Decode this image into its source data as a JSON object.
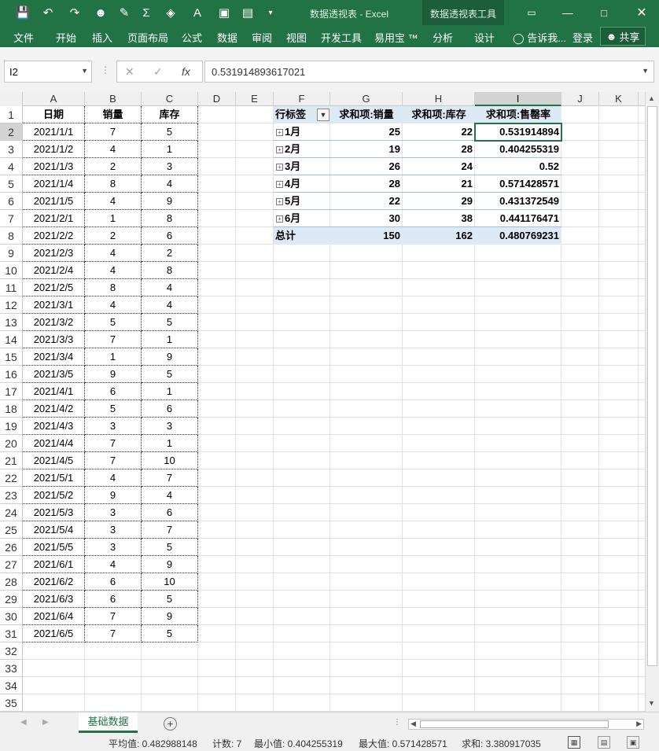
{
  "window": {
    "title": "数据透视表 - Excel",
    "context_tab_group": "数据透视表工具"
  },
  "ribbon": {
    "tabs": [
      "文件",
      "开始",
      "插入",
      "页面布局",
      "公式",
      "数据",
      "审阅",
      "视图",
      "开发工具",
      "易用宝 ™",
      "分析",
      "设计"
    ],
    "tell_me": "告诉我...",
    "login": "登录",
    "share": "共享"
  },
  "formula_bar": {
    "name_box": "I2",
    "fx": "fx",
    "value": "0.531914893617021"
  },
  "columns": [
    "A",
    "B",
    "C",
    "D",
    "E",
    "F",
    "G",
    "H",
    "I",
    "J",
    "K"
  ],
  "rows": [
    "1",
    "2",
    "3",
    "4",
    "5",
    "6",
    "7",
    "8",
    "9",
    "10",
    "11",
    "12",
    "13",
    "14",
    "15",
    "16",
    "17",
    "18",
    "19",
    "20",
    "21",
    "22",
    "23",
    "24",
    "25",
    "26",
    "27",
    "28",
    "29",
    "30",
    "31",
    "32",
    "33",
    "34",
    "35"
  ],
  "base_data": {
    "headers": [
      "日期",
      "销量",
      "库存"
    ],
    "records": [
      [
        "2021/1/1",
        "7",
        "5"
      ],
      [
        "2021/1/2",
        "4",
        "1"
      ],
      [
        "2021/1/3",
        "2",
        "3"
      ],
      [
        "2021/1/4",
        "8",
        "4"
      ],
      [
        "2021/1/5",
        "4",
        "9"
      ],
      [
        "2021/2/1",
        "1",
        "8"
      ],
      [
        "2021/2/2",
        "2",
        "6"
      ],
      [
        "2021/2/3",
        "4",
        "2"
      ],
      [
        "2021/2/4",
        "4",
        "8"
      ],
      [
        "2021/2/5",
        "8",
        "4"
      ],
      [
        "2021/3/1",
        "4",
        "4"
      ],
      [
        "2021/3/2",
        "5",
        "5"
      ],
      [
        "2021/3/3",
        "7",
        "1"
      ],
      [
        "2021/3/4",
        "1",
        "9"
      ],
      [
        "2021/3/5",
        "9",
        "5"
      ],
      [
        "2021/4/1",
        "6",
        "1"
      ],
      [
        "2021/4/2",
        "5",
        "6"
      ],
      [
        "2021/4/3",
        "3",
        "3"
      ],
      [
        "2021/4/4",
        "7",
        "1"
      ],
      [
        "2021/4/5",
        "7",
        "10"
      ],
      [
        "2021/5/1",
        "4",
        "7"
      ],
      [
        "2021/5/2",
        "9",
        "4"
      ],
      [
        "2021/5/3",
        "3",
        "6"
      ],
      [
        "2021/5/4",
        "3",
        "7"
      ],
      [
        "2021/5/5",
        "3",
        "5"
      ],
      [
        "2021/6/1",
        "4",
        "9"
      ],
      [
        "2021/6/2",
        "6",
        "10"
      ],
      [
        "2021/6/3",
        "6",
        "5"
      ],
      [
        "2021/6/4",
        "7",
        "9"
      ],
      [
        "2021/6/5",
        "7",
        "5"
      ]
    ]
  },
  "pivot": {
    "headers": [
      "行标签",
      "求和项:销量",
      "求和项:库存",
      "求和项:售罄率"
    ],
    "rows": [
      [
        "1月",
        "25",
        "22",
        "0.531914894"
      ],
      [
        "2月",
        "19",
        "28",
        "0.404255319"
      ],
      [
        "3月",
        "26",
        "24",
        "0.52"
      ],
      [
        "4月",
        "28",
        "21",
        "0.571428571"
      ],
      [
        "5月",
        "22",
        "29",
        "0.431372549"
      ],
      [
        "6月",
        "30",
        "38",
        "0.441176471"
      ]
    ],
    "total": [
      "总计",
      "150",
      "162",
      "0.480769231"
    ]
  },
  "sheet_tab": "基础数据",
  "status": {
    "average": "平均值: 0.482988148",
    "count": "计数: 7",
    "min": "最小值: 0.404255319",
    "max": "最大值: 0.571428571",
    "sum": "求和: 3.380917035"
  },
  "colors": {
    "excel_green": "#217346",
    "pivot_fill": "#dde9f5"
  }
}
